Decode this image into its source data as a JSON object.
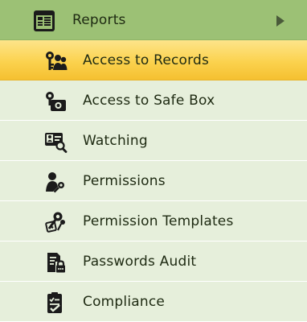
{
  "header": {
    "label": "Reports",
    "icon": "report-table-icon",
    "arrow_icon": "chevron-right-icon"
  },
  "items": [
    {
      "label": "Access to Records",
      "icon": "users-key-icon",
      "active": true
    },
    {
      "label": "Access to Safe Box",
      "icon": "safe-box-key-icon",
      "active": false
    },
    {
      "label": "Watching",
      "icon": "id-card-search-icon",
      "active": false
    },
    {
      "label": "Permissions",
      "icon": "person-key-icon",
      "active": false
    },
    {
      "label": "Permission Templates",
      "icon": "templates-key-icon",
      "active": false
    },
    {
      "label": "Passwords Audit",
      "icon": "document-lock-icon",
      "active": false
    },
    {
      "label": "Compliance",
      "icon": "clipboard-check-icon",
      "active": false
    }
  ],
  "colors": {
    "header_bg": "#9cc175",
    "item_bg": "#e6efdb",
    "active_bg": "#fbd24e",
    "text": "#1e2a12"
  }
}
